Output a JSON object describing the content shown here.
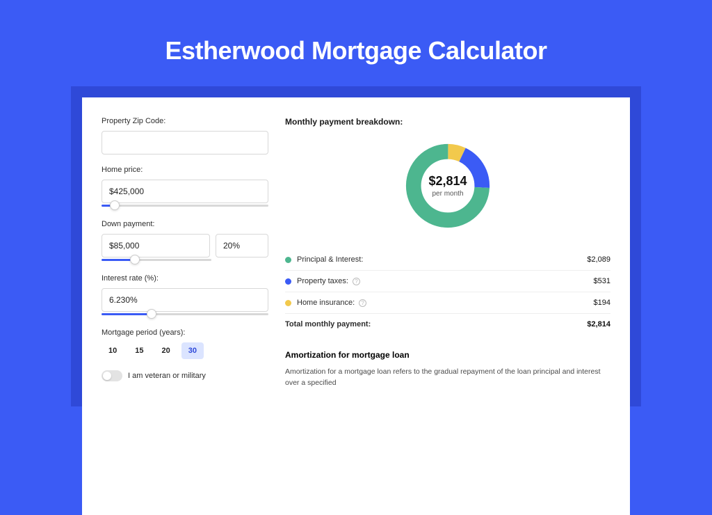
{
  "title": "Estherwood Mortgage Calculator",
  "form": {
    "zip_label": "Property Zip Code:",
    "zip_value": "",
    "price_label": "Home price:",
    "price_value": "$425,000",
    "price_slider_pct": 8,
    "down_label": "Down payment:",
    "down_value": "$85,000",
    "down_pct_value": "20%",
    "down_slider_pct": 20,
    "rate_label": "Interest rate (%):",
    "rate_value": "6.230%",
    "rate_slider_pct": 30,
    "period_label": "Mortgage period (years):",
    "periods": [
      "10",
      "15",
      "20",
      "30"
    ],
    "period_active_index": 3,
    "veteran_label": "I am veteran or military",
    "veteran_on": false
  },
  "breakdown": {
    "title": "Monthly payment breakdown:",
    "center_amount": "$2,814",
    "center_sub": "per month",
    "items": [
      {
        "color": "#4db68f",
        "label": "Principal & Interest:",
        "value": "$2,089",
        "info": false
      },
      {
        "color": "#3b5bf5",
        "label": "Property taxes:",
        "value": "$531",
        "info": true
      },
      {
        "color": "#f2c94c",
        "label": "Home insurance:",
        "value": "$194",
        "info": true
      }
    ],
    "total_label": "Total monthly payment:",
    "total_value": "$2,814"
  },
  "amort": {
    "title": "Amortization for mortgage loan",
    "text": "Amortization for a mortgage loan refers to the gradual repayment of the loan principal and interest over a specified"
  },
  "chart_data": {
    "type": "pie",
    "title": "Monthly payment breakdown",
    "series": [
      {
        "name": "Principal & Interest",
        "value": 2089,
        "color": "#4db68f"
      },
      {
        "name": "Property taxes",
        "value": 531,
        "color": "#3b5bf5"
      },
      {
        "name": "Home insurance",
        "value": 194,
        "color": "#f2c94c"
      }
    ],
    "total": 2814,
    "center_label": "$2,814 per month",
    "donut": true
  }
}
